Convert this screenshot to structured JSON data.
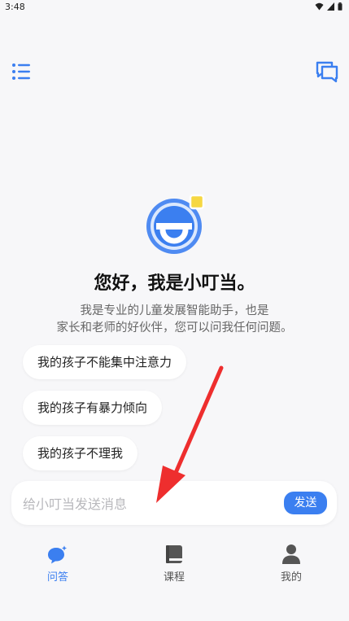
{
  "status_bar": {
    "time": "3:48",
    "icons": [
      "wifi-icon",
      "signal-icon",
      "battery-icon"
    ]
  },
  "header": {
    "menu_icon": "list-icon",
    "chat_icon": "chat-bubbles-icon"
  },
  "assistant": {
    "greeting": "您好，我是小叮当。",
    "intro_line1": "我是专业的儿童发展智能助手，也是",
    "intro_line2": "家长和老师的好伙伴，您可以问我任何问题。"
  },
  "suggestions": [
    {
      "label": "我的孩子不能集中注意力"
    },
    {
      "label": "我的孩子有暴力倾向"
    },
    {
      "label": "我的孩子不理我"
    }
  ],
  "input": {
    "placeholder": "给小叮当发送消息",
    "value": "",
    "send_label": "发送"
  },
  "bottom_nav": {
    "items": [
      {
        "label": "问答",
        "icon": "chat-sparkle-icon",
        "active": true
      },
      {
        "label": "课程",
        "icon": "book-icon",
        "active": false
      },
      {
        "label": "我的",
        "icon": "person-icon",
        "active": false
      }
    ]
  },
  "colors": {
    "accent": "#3b7ff0",
    "background": "#f7f7f9",
    "annotation_arrow": "#ee2e2e"
  }
}
